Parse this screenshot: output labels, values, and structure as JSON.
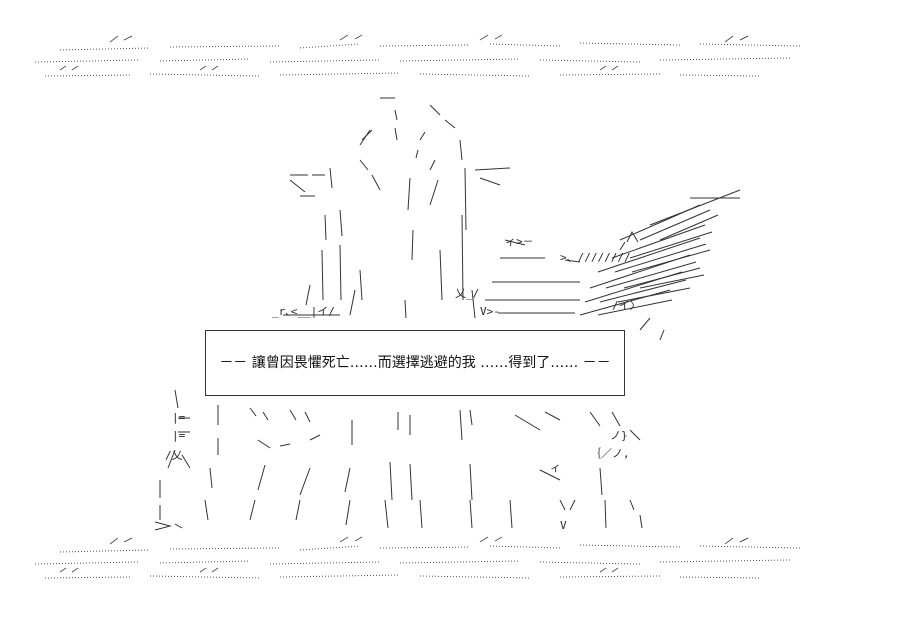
{
  "caption": {
    "text": "－－ 讓曾因畏懼死亡……而選擇逃避的我 ……得到了…… －－"
  },
  "art": {
    "top_border_1": "～～''\"\"～～～～～～～～''\"\"'''～～～～～～''\"\"''～～～～～～～''\"\"'\"\"～～～～～''\"\"'～",
    "top_border_2": ",,''\"\"'\"\"\"\"～～～～～～～～～～～～～～～～～～''\"\"～～～～～～～～～～～～～～～～～～～～～～～～…",
    "bottom_border_1": "～～''\"\"～～～～～～～～''\"\"'''～～～～～～''\"\"''～～～～～～～''\"\"'\"\"～～～～～''\"\"'～",
    "bottom_border_2": ",,''\"\"'\"\"\"\"～～～～～～～～～～～～～～～～～～''\"\"～～～～～～～～～～～～～～～～～～～～～～～～…"
  }
}
